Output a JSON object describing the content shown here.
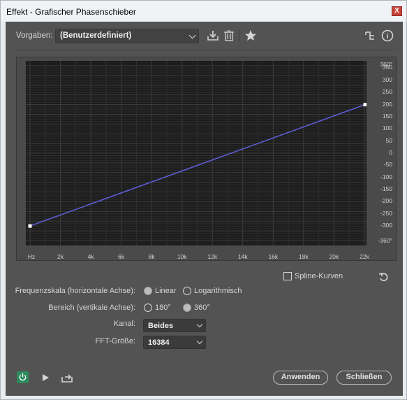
{
  "window": {
    "title": "Effekt - Grafischer Phasenschieber",
    "close_glyph": "X"
  },
  "toolbar": {
    "presets_label": "Vorgaben:",
    "preset_value": "(Benutzerdefiniert)",
    "icons": [
      "download-icon",
      "trash-icon",
      "star-icon",
      "routing-icon",
      "info-icon"
    ],
    "info_glyph": "i"
  },
  "graph": {
    "y_ticks": [
      "360°",
      "350",
      "300",
      "250",
      "200",
      "150",
      "100",
      "50",
      "0",
      "-50",
      "-100",
      "-150",
      "-200",
      "-250",
      "-300",
      "-360°"
    ],
    "x_ticks": [
      "Hz",
      "2k",
      "4k",
      "6k",
      "8k",
      "10k",
      "12k",
      "14k",
      "16k",
      "18k",
      "20k",
      "22k"
    ],
    "curve": {
      "points": [
        {
          "freq_hz": 0,
          "phase_deg": -300
        },
        {
          "freq_hz": 22050,
          "phase_deg": 200
        }
      ],
      "color": "#5c5cd6"
    }
  },
  "spline": {
    "label": "Spline-Kurven",
    "checked": false
  },
  "controls": {
    "freq_scale": {
      "label": "Frequenzskala (horizontale Achse):",
      "options": [
        "Linear",
        "Logarithmisch"
      ],
      "selected": "Linear"
    },
    "range": {
      "label": "Bereich (vertikale Achse):",
      "options": [
        "180°",
        "360°"
      ],
      "selected": "360°"
    },
    "channel": {
      "label": "Kanal:",
      "value": "Beides"
    },
    "fft": {
      "label": "FFT-Größe:",
      "value": "16384"
    }
  },
  "footer": {
    "apply_label": "Anwenden",
    "close_label": "Schließen",
    "power_color": "#2e8b5c"
  }
}
